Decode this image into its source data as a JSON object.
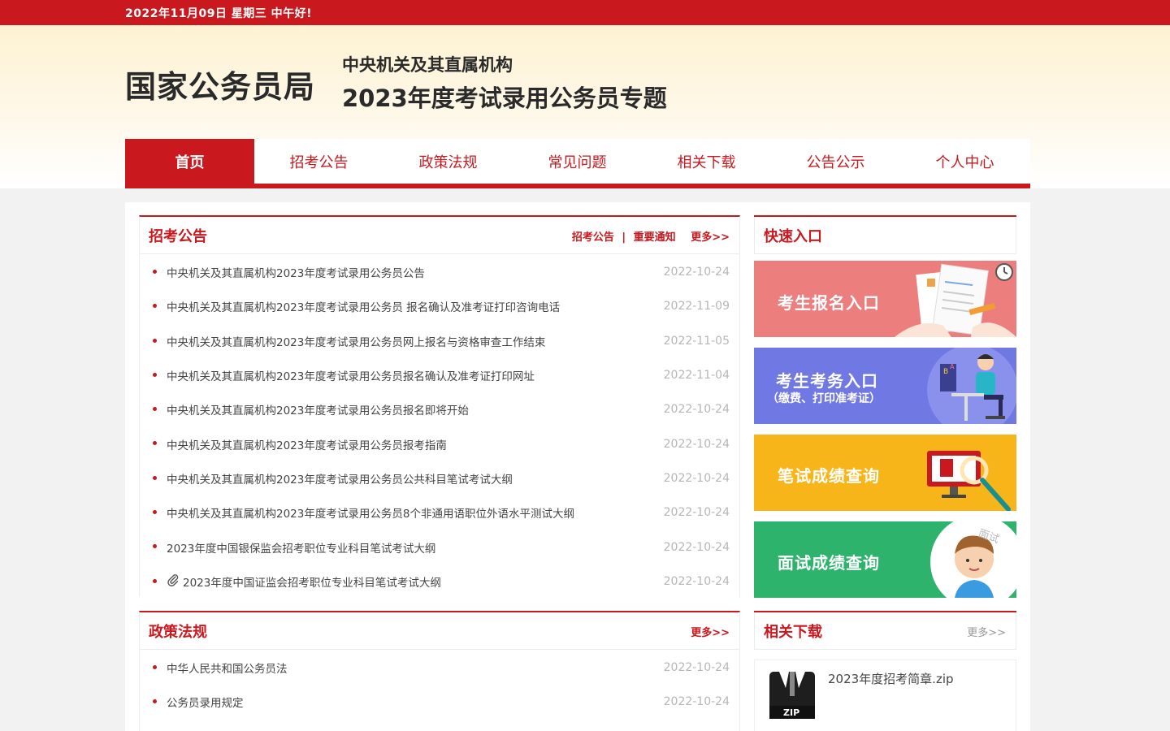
{
  "topbar": {
    "date_text": "2022年11月09日  星期三  中午好!"
  },
  "header": {
    "site_title": "国家公务员局",
    "subtitle_line1": "中央机关及其直属机构",
    "subtitle_line2": "2023年度考试录用公务员专题"
  },
  "nav": {
    "items": [
      {
        "label": "首页",
        "active": true
      },
      {
        "label": "招考公告"
      },
      {
        "label": "政策法规"
      },
      {
        "label": "常见问题"
      },
      {
        "label": "相关下载"
      },
      {
        "label": "公告公示"
      },
      {
        "label": "个人中心"
      }
    ]
  },
  "recruit": {
    "title": "招考公告",
    "link1": "招考公告",
    "separator": "|",
    "link2": "重要通知",
    "more": "更多>>",
    "items": [
      {
        "title": "中央机关及其直属机构2023年度考试录用公务员公告",
        "date": "2022-10-24"
      },
      {
        "title": "中央机关及其直属机构2023年度考试录用公务员 报名确认及准考证打印咨询电话",
        "date": "2022-11-09"
      },
      {
        "title": "中央机关及其直属机构2023年度考试录用公务员网上报名与资格审查工作结束",
        "date": "2022-11-05"
      },
      {
        "title": "中央机关及其直属机构2023年度考试录用公务员报名确认及准考证打印网址",
        "date": "2022-11-04"
      },
      {
        "title": "中央机关及其直属机构2023年度考试录用公务员报名即将开始",
        "date": "2022-10-24"
      },
      {
        "title": "中央机关及其直属机构2023年度考试录用公务员报考指南",
        "date": "2022-10-24"
      },
      {
        "title": "中央机关及其直属机构2023年度考试录用公务员公共科目笔试考试大纲",
        "date": "2022-10-24"
      },
      {
        "title": "中央机关及其直属机构2023年度考试录用公务员8个非通用语职位外语水平测试大纲",
        "date": "2022-10-24"
      },
      {
        "title": "2023年度中国银保监会招考职位专业科目笔试考试大纲",
        "date": "2022-10-24"
      },
      {
        "title": "2023年度中国证监会招考职位专业科目笔试考试大纲",
        "date": "2022-10-24",
        "attachment": true
      }
    ]
  },
  "policy": {
    "title": "政策法规",
    "more": "更多>>",
    "items": [
      {
        "title": "中华人民共和国公务员法",
        "date": "2022-10-24"
      },
      {
        "title": "公务员录用规定",
        "date": "2022-10-24"
      }
    ]
  },
  "quick": {
    "title": "快速入口",
    "entries": [
      {
        "label": "考生报名入口",
        "color": "#ec7e7e",
        "icon": "form-icon"
      },
      {
        "label": "考生考务入口",
        "sub": "（缴费、打印准考证）",
        "color": "#6f78e3",
        "icon": "student-at-desk-icon"
      },
      {
        "label": "笔试成绩查询",
        "color": "#f7b51a",
        "icon": "monitor-icon"
      },
      {
        "label": "面试成绩查询",
        "color": "#2eb36d",
        "icon": "interview-avatar-icon",
        "badge": "面试"
      }
    ]
  },
  "downloads": {
    "title": "相关下载",
    "more": "更多>>",
    "items": [
      {
        "name": "2023年度招考简章.zip",
        "icon": "zip-icon",
        "badge": "ZIP"
      }
    ]
  }
}
